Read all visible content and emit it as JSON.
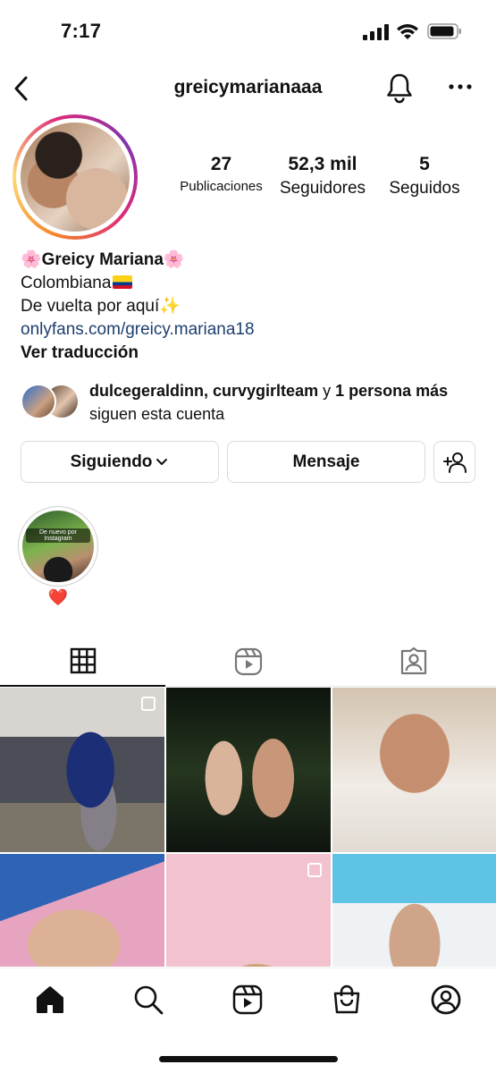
{
  "status_bar": {
    "time": "7:17"
  },
  "header": {
    "username": "greicymarianaaa"
  },
  "stats": {
    "posts": {
      "count": "27",
      "label": "Publicaciones"
    },
    "followers": {
      "count": "52,3 mil",
      "label": "Seguidores"
    },
    "following": {
      "count": "5",
      "label": "Seguidos"
    }
  },
  "bio": {
    "name": "🌸Greicy Mariana🌸",
    "line1": "Colombiana",
    "line2": "De vuelta por aquí✨",
    "link": "onlyfans.com/greicy.mariana18",
    "translate": "Ver traducción"
  },
  "mutual": {
    "names": "dulcegeraldinn, curvygirlteam",
    "connector": " y ",
    "others": "1 persona más",
    "suffix": " siguen esta cuenta"
  },
  "buttons": {
    "following": "Siguiendo",
    "message": "Mensaje"
  },
  "highlights": [
    {
      "title": "❤️",
      "overlay": "De nuevo por Instagram"
    }
  ],
  "colors": {
    "link": "#1d3e6e",
    "story_ring": [
      "#f58529",
      "#feda77",
      "#dd2a7b",
      "#8134af"
    ]
  },
  "icons": [
    "back-icon",
    "bell-icon",
    "more-icon",
    "chevron-down-icon",
    "add-person-icon",
    "grid-icon",
    "reels-icon",
    "tagged-icon",
    "home-icon",
    "search-icon",
    "shop-icon",
    "profile-icon"
  ]
}
